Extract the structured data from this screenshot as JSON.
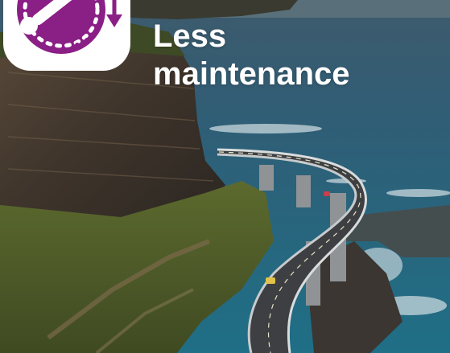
{
  "headline": {
    "line1": "Less",
    "line2": "maintenance"
  },
  "badge": {
    "icon": "wrench-arrow-down-icon",
    "accent_color": "#8a1f86"
  },
  "photo": {
    "subject": "coastal-bridge-photo"
  }
}
